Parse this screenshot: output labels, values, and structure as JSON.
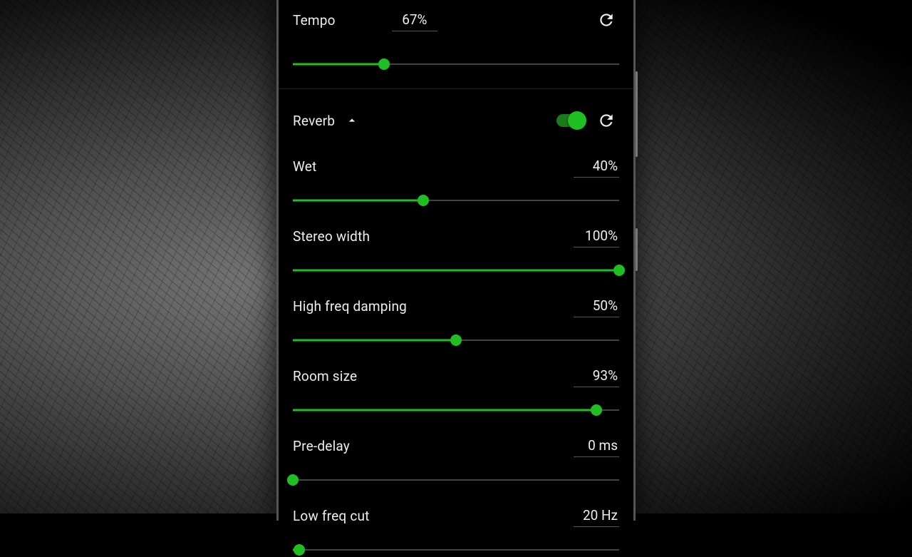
{
  "colors": {
    "accent": "#1fbf23"
  },
  "tempo": {
    "label": "Tempo",
    "value": "67%",
    "pct": 28
  },
  "reverb": {
    "title": "Reverb",
    "enabled": true,
    "params": [
      {
        "label": "Wet",
        "value": "40%",
        "pct": 40
      },
      {
        "label": "Stereo width",
        "value": "100%",
        "pct": 100
      },
      {
        "label": "High freq damping",
        "value": "50%",
        "pct": 50
      },
      {
        "label": "Room size",
        "value": "93%",
        "pct": 93
      },
      {
        "label": "Pre-delay",
        "value": "0 ms",
        "pct": 0
      },
      {
        "label": "Low freq cut",
        "value": "20 Hz",
        "pct": 2
      }
    ]
  }
}
